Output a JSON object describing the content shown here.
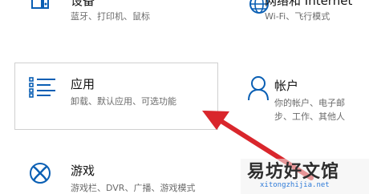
{
  "tiles": {
    "devices": {
      "title": "设备",
      "desc": "蓝牙、打印机、鼠标",
      "icon": "devices-icon"
    },
    "network": {
      "title": "网络和 Internet",
      "desc": "Wi-Fi、飞行模式",
      "icon": "globe-icon"
    },
    "apps": {
      "title": "应用",
      "desc": "卸载、默认应用、可选功能",
      "icon": "apps-list-icon"
    },
    "accounts": {
      "title": "帐户",
      "desc_line1": "你的帐户、电子邮",
      "desc_line2": "步、工作、其他人",
      "icon": "person-icon"
    },
    "gaming": {
      "title": "游戏",
      "desc": "游戏栏、DVR、广播、游戏模式",
      "icon": "xbox-icon"
    }
  },
  "annotation": {
    "arrow_color": "#d9262c"
  },
  "watermark": {
    "main": "易坊好文馆",
    "sub": "xitongzhijia.net"
  },
  "colors": {
    "accent": "#0a5fb4"
  }
}
